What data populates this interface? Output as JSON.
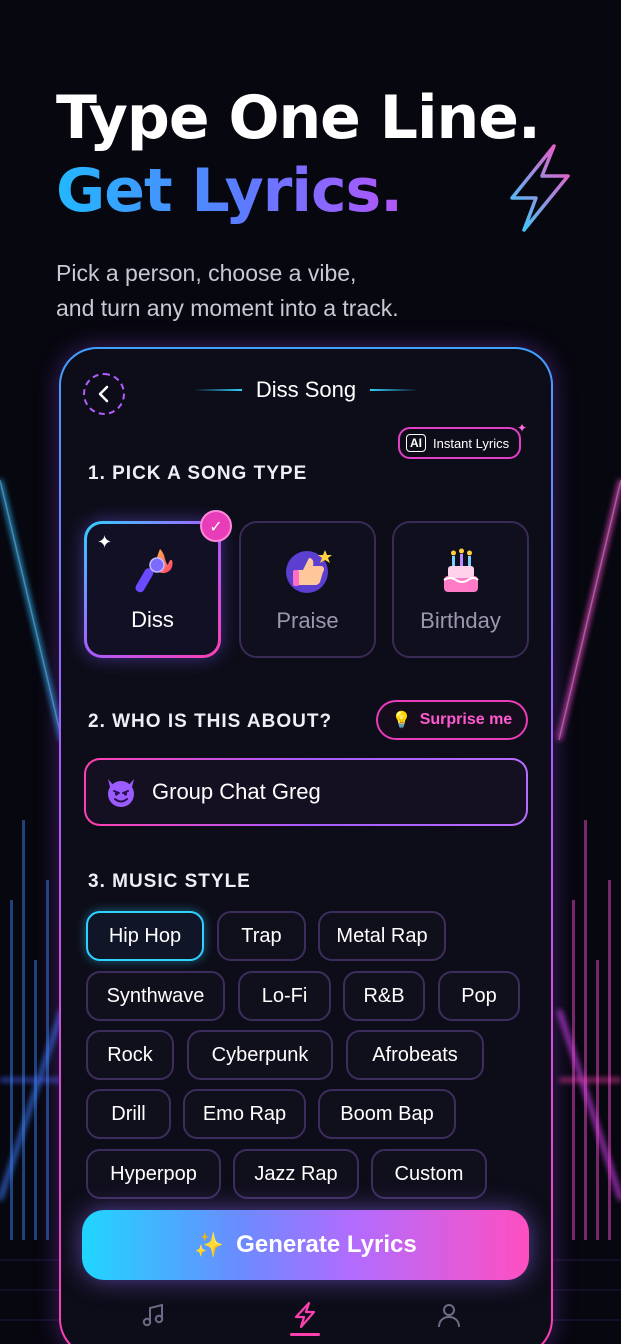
{
  "hero": {
    "title_line1": "Type One Line.",
    "title_line2": "Get Lyrics.",
    "subtitle_line1": "Pick a person, choose a vibe,",
    "subtitle_line2": "and turn any moment into a track."
  },
  "screen": {
    "title": "Diss Song",
    "ai_badge": {
      "ai_text": "AI",
      "label": "Instant Lyrics"
    }
  },
  "step1": {
    "label": "1. PICK A SONG TYPE",
    "types": [
      {
        "label": "Diss",
        "icon": "microphone-fire-icon",
        "selected": true
      },
      {
        "label": "Praise",
        "icon": "thumbs-up-star-icon",
        "selected": false
      },
      {
        "label": "Birthday",
        "icon": "birthday-cake-icon",
        "selected": false
      }
    ]
  },
  "step2": {
    "label": "2. WHO IS THIS ABOUT?",
    "surprise_label": "Surprise me",
    "person_value": "Group Chat Greg"
  },
  "step3": {
    "label": "3. MUSIC STYLE",
    "styles": [
      "Hip Hop",
      "Trap",
      "Metal Rap",
      "Synthwave",
      "Lo-Fi",
      "R&B",
      "Pop",
      "Rock",
      "Cyberpunk",
      "Afrobeats",
      "Drill",
      "Emo Rap",
      "Boom Bap",
      "Hyperpop",
      "Jazz Rap",
      "Custom"
    ],
    "selected": "Hip Hop"
  },
  "generate_label": "Generate Lyrics",
  "tabs": [
    {
      "icon": "music-note-icon",
      "active": false
    },
    {
      "icon": "lightning-icon",
      "active": true
    },
    {
      "icon": "profile-icon",
      "active": false
    }
  ],
  "colors": {
    "accent_cyan": "#2fd1ff",
    "accent_purple": "#a85cff",
    "accent_pink": "#ff3fb0",
    "background": "#07070f"
  }
}
